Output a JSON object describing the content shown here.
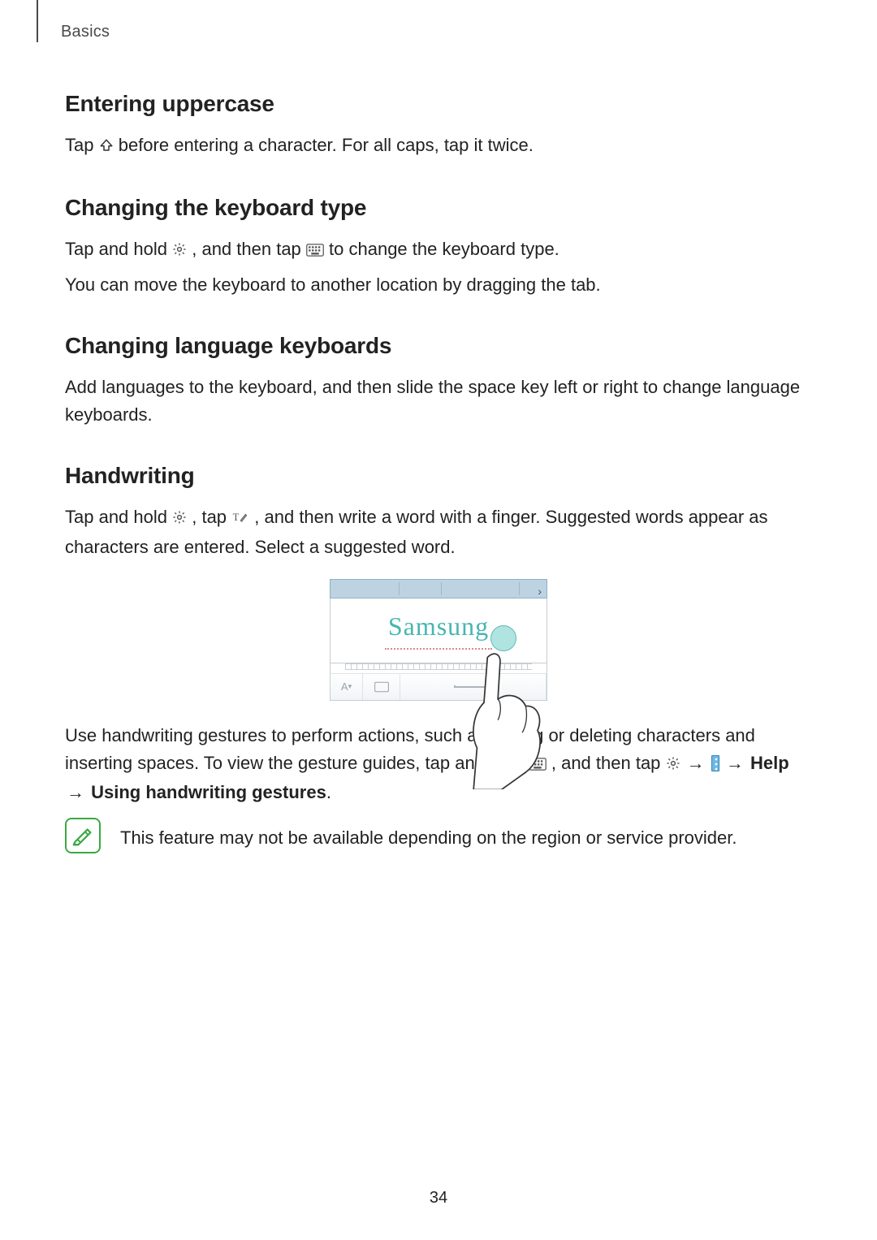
{
  "breadcrumb": "Basics",
  "page_number": "34",
  "sections": {
    "uppercase": {
      "title": "Entering uppercase",
      "p1a": "Tap ",
      "p1b": " before entering a character. For all caps, tap it twice."
    },
    "kbd_type": {
      "title": "Changing the keyboard type",
      "p1a": "Tap and hold ",
      "p1b": ", and then tap ",
      "p1c": " to change the keyboard type.",
      "p2": "You can move the keyboard to another location by dragging the tab."
    },
    "lang": {
      "title": "Changing language keyboards",
      "p1": "Add languages to the keyboard, and then slide the space key left or right to change language keyboards."
    },
    "hand": {
      "title": "Handwriting",
      "p1a": "Tap and hold ",
      "p1b": ", tap ",
      "p1c": ", and then write a word with a finger. Suggested words appear as characters are entered. Select a suggested word.",
      "fig_text": "Samsung",
      "p2a": "Use handwriting gestures to perform actions, such as editing or deleting characters and inserting spaces. To view the gesture guides, tap and hold ",
      "p2b": ", and then tap ",
      "arrow": "→",
      "help": "Help",
      "p2c": "Using handwriting gestures",
      "p2d": ".",
      "note": "This feature may not be available depending on the region or service provider."
    }
  }
}
